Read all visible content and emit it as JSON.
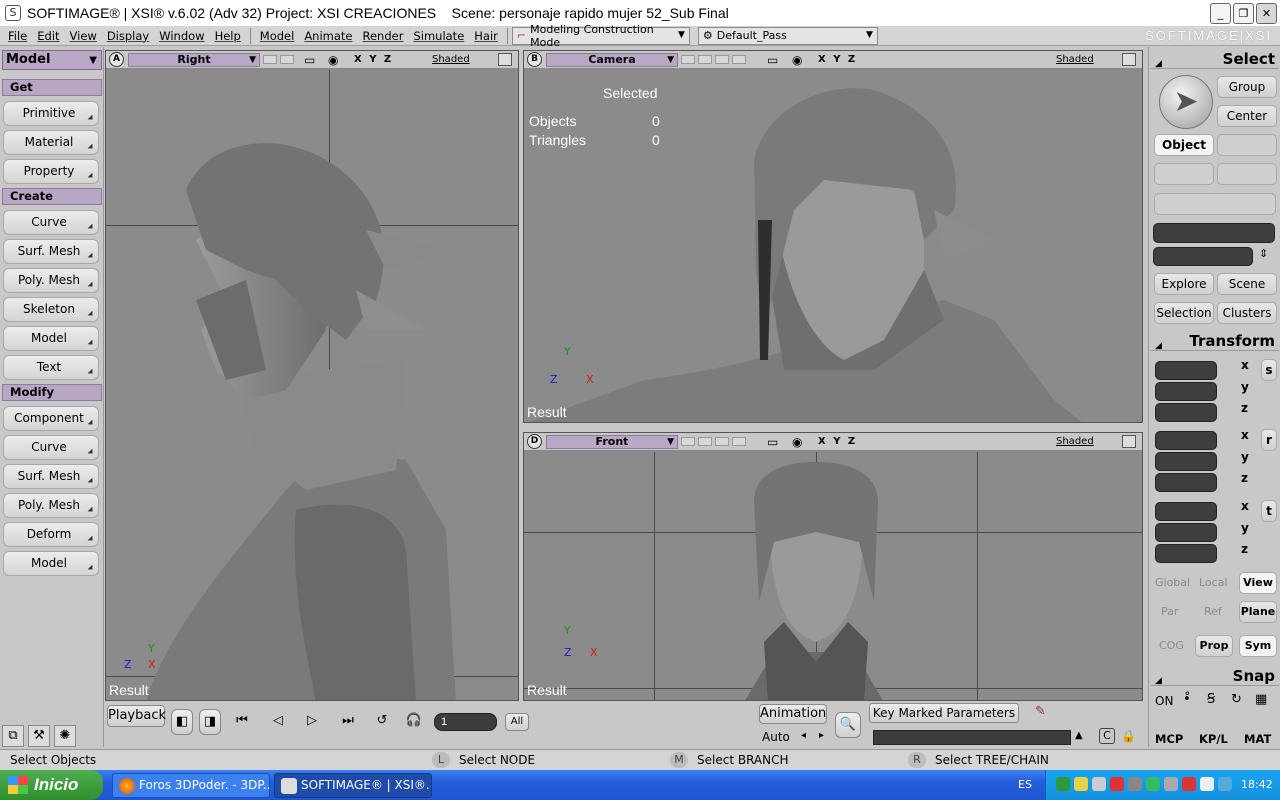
{
  "window": {
    "title": "SOFTIMAGE® | XSI® v.6.02 (Adv 32) Project: XSI CREACIONES    Scene: personaje rapido mujer 52_Sub Final",
    "brand": "SOFTIMAGE|XSI"
  },
  "menubar": {
    "items": [
      "File",
      "Edit",
      "View",
      "Display",
      "Window",
      "Help",
      "Model",
      "Animate",
      "Render",
      "Simulate",
      "Hair"
    ],
    "construction_mode": "Modeling Construction Mode",
    "pass": "Default_Pass"
  },
  "left_panel": {
    "mode": "Model",
    "sections": [
      {
        "title": "Get",
        "buttons": [
          "Primitive",
          "Material",
          "Property"
        ]
      },
      {
        "title": "Create",
        "buttons": [
          "Curve",
          "Surf. Mesh",
          "Poly. Mesh",
          "Skeleton",
          "Model",
          "Text"
        ]
      },
      {
        "title": "Modify",
        "buttons": [
          "Component",
          "Curve",
          "Surf. Mesh",
          "Poly. Mesh",
          "Deform",
          "Model"
        ]
      }
    ]
  },
  "viewports": {
    "a": {
      "letter": "A",
      "view": "Right",
      "xyz": "X Y Z",
      "shading": "Shaded",
      "label": "Result"
    },
    "b": {
      "letter": "B",
      "view": "Camera",
      "xyz": "X Y Z",
      "shading": "Shaded",
      "label": "Result",
      "stats": {
        "heading": "Selected",
        "objects_label": "Objects",
        "objects_value": "0",
        "triangles_label": "Triangles",
        "triangles_value": "0"
      }
    },
    "d": {
      "letter": "D",
      "view": "Front",
      "xyz": "X Y Z",
      "shading": "Shaded",
      "label": "Result"
    }
  },
  "axis_labels": {
    "y": "Y",
    "x": "X",
    "z": "Z"
  },
  "right_panel": {
    "select_title": "Select",
    "group": "Group",
    "center": "Center",
    "object": "Object",
    "explore": "Explore",
    "scene": "Scene",
    "selection": "Selection",
    "clusters": "Clusters",
    "transform_title": "Transform",
    "axes": [
      "x",
      "y",
      "z"
    ],
    "transform_icons": [
      "s",
      "r",
      "t"
    ],
    "global": "Global",
    "local": "Local",
    "view": "View",
    "par": "Par",
    "ref": "Ref",
    "plane": "Plane",
    "cog": "COG",
    "prop": "Prop",
    "sym": "Sym",
    "snap_title": "Snap",
    "snap_on": "ON",
    "tabs": [
      "MCP",
      "KP/L",
      "MAT"
    ]
  },
  "timeline": {
    "playback": "Playback",
    "frame": "1",
    "all": "All",
    "animation": "Animation",
    "auto": "Auto",
    "key_marked": "Key Marked Parameters"
  },
  "statusbar": {
    "message": "Select Objects",
    "l_key": "L",
    "l_text": "Select NODE",
    "m_key": "M",
    "m_text": "Select BRANCH",
    "r_key": "R",
    "r_text": "Select TREE/CHAIN"
  },
  "taskbar": {
    "start": "Inicio",
    "tasks": [
      "Foros 3DPoder. - 3DP...",
      "SOFTIMAGE® | XSI®..."
    ],
    "lang": "ES",
    "clock": "18:42"
  }
}
